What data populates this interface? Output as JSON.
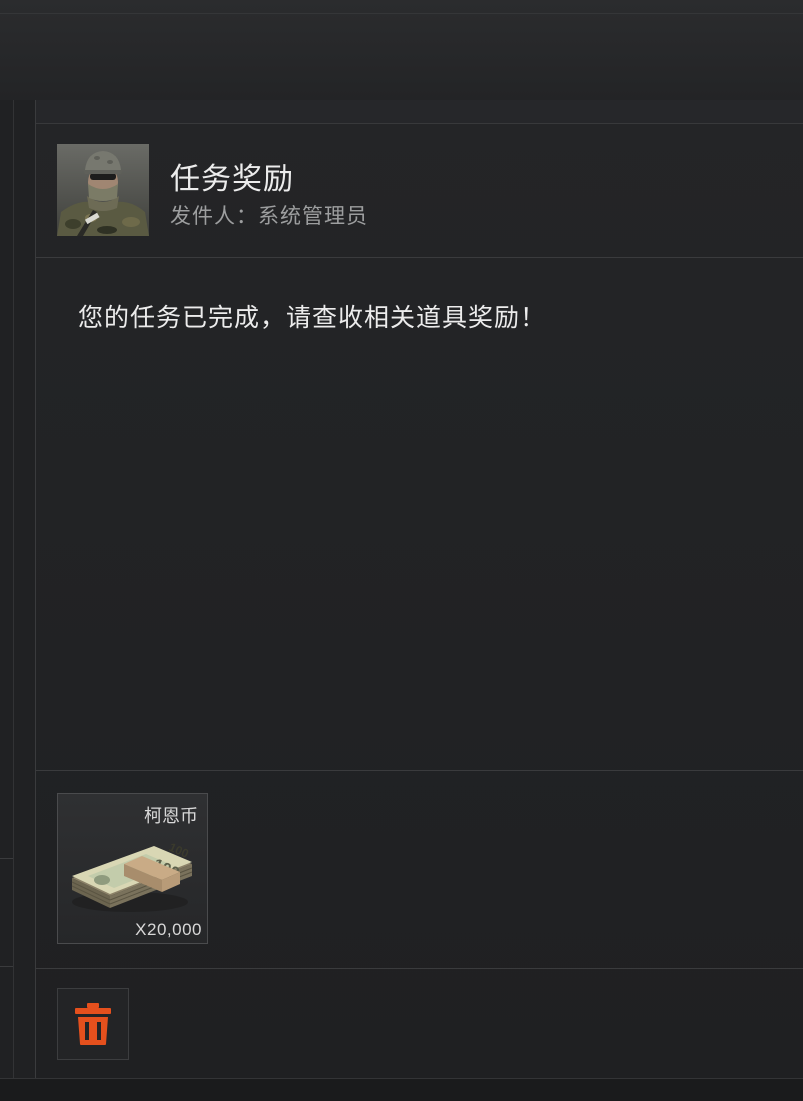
{
  "mail": {
    "title": "任务奖励",
    "sender": "发件人：系统管理员",
    "body": "您的任务已完成，请查收相关道具奖励！"
  },
  "attachment": {
    "name": "柯恩币",
    "quantity": "X20,000",
    "icon": "banknote-bundle-icon"
  },
  "actions": {
    "delete_icon": "trash-icon",
    "delete_color": "#e5501d"
  }
}
